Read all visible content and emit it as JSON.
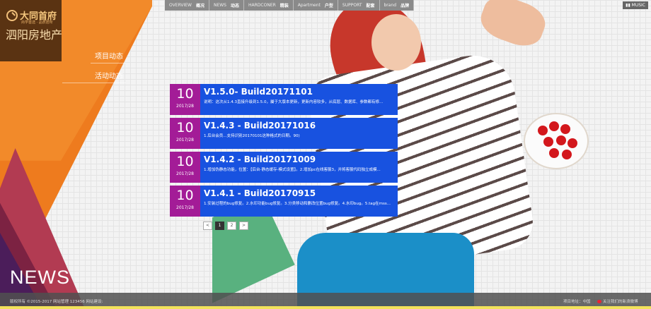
{
  "logo": {
    "cn_top": "大同首府",
    "cn_sub": "尚学首选 · 品质居所",
    "cn_big": "泗阳房地产"
  },
  "side_nav": {
    "items": [
      {
        "label": "项目动态"
      },
      {
        "label": "活动动态"
      }
    ]
  },
  "top_nav": {
    "items": [
      {
        "en": "OVERVIEW",
        "cn": "概况"
      },
      {
        "en": "NEWS",
        "cn": "动态"
      },
      {
        "en": "HARDCONER",
        "cn": "精装"
      },
      {
        "en": "Apartment",
        "cn": "户型"
      },
      {
        "en": "SUPPORT",
        "cn": "配套"
      },
      {
        "en": "brand",
        "cn": "品牌"
      }
    ],
    "music": "MUSIC"
  },
  "news": {
    "items": [
      {
        "day": "10",
        "ym": "2017/28",
        "title": "V1.5.0- Build20171101",
        "desc": "说明：这次从1.4.3直接升级到1.5.0，屬于大版本更新，更新内容较多，从底层、数据库、参数都有修..."
      },
      {
        "day": "10",
        "ym": "2017/28",
        "title": "V1.4.3 - Build20171016",
        "desc": "1.后台会员...支持识别20170101这种格式的日期。90)"
      },
      {
        "day": "10",
        "ym": "2017/28",
        "title": "V1.4.2 - Build20171009",
        "desc": "1.增加伪静态功能，位置：【后台-静态缓存-模式设置】。2.增加pc在线客服3，并将客服代码独立成模..."
      },
      {
        "day": "10",
        "ym": "2017/28",
        "title": "V1.4.1 - Build20170915",
        "desc": "1.安装过程的bug修复。2.水印功能bug修复。3.分类移动和删改位置bug修复。4.水印bug。5.tag在mss..."
      }
    ]
  },
  "pager": {
    "prev": "<",
    "pages": [
      "1",
      "2"
    ],
    "next": ">"
  },
  "left": {
    "news_word": "NEWS"
  },
  "footer": {
    "copy": "版权所有 ©2015-2017 网站管理 123456 网站建设:",
    "addr": "项目地址：中国",
    "weibo": "关注我们的新浪微博"
  }
}
